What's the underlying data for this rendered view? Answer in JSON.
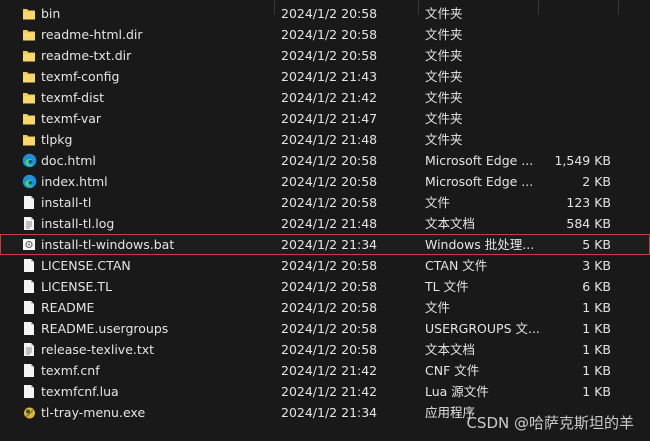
{
  "files": [
    {
      "name": "bin",
      "date": "2024/1/2 20:58",
      "type": "文件夹",
      "size": "",
      "icon": "folder-icon"
    },
    {
      "name": "readme-html.dir",
      "date": "2024/1/2 20:58",
      "type": "文件夹",
      "size": "",
      "icon": "folder-icon"
    },
    {
      "name": "readme-txt.dir",
      "date": "2024/1/2 20:58",
      "type": "文件夹",
      "size": "",
      "icon": "folder-icon"
    },
    {
      "name": "texmf-config",
      "date": "2024/1/2 21:43",
      "type": "文件夹",
      "size": "",
      "icon": "folder-icon"
    },
    {
      "name": "texmf-dist",
      "date": "2024/1/2 21:42",
      "type": "文件夹",
      "size": "",
      "icon": "folder-icon"
    },
    {
      "name": "texmf-var",
      "date": "2024/1/2 21:47",
      "type": "文件夹",
      "size": "",
      "icon": "folder-icon"
    },
    {
      "name": "tlpkg",
      "date": "2024/1/2 21:48",
      "type": "文件夹",
      "size": "",
      "icon": "folder-icon"
    },
    {
      "name": "doc.html",
      "date": "2024/1/2 20:58",
      "type": "Microsoft Edge ...",
      "size": "1,549 KB",
      "icon": "edge-icon"
    },
    {
      "name": "index.html",
      "date": "2024/1/2 20:58",
      "type": "Microsoft Edge ...",
      "size": "2 KB",
      "icon": "edge-icon"
    },
    {
      "name": "install-tl",
      "date": "2024/1/2 20:58",
      "type": "文件",
      "size": "123 KB",
      "icon": "file-icon"
    },
    {
      "name": "install-tl.log",
      "date": "2024/1/2 21:48",
      "type": "文本文档",
      "size": "584 KB",
      "icon": "text-file-icon"
    },
    {
      "name": "install-tl-windows.bat",
      "date": "2024/1/2 21:34",
      "type": "Windows 批处理...",
      "size": "5 KB",
      "icon": "batch-file-icon",
      "selected": true
    },
    {
      "name": "LICENSE.CTAN",
      "date": "2024/1/2 20:58",
      "type": "CTAN 文件",
      "size": "3 KB",
      "icon": "file-icon"
    },
    {
      "name": "LICENSE.TL",
      "date": "2024/1/2 20:58",
      "type": "TL 文件",
      "size": "6 KB",
      "icon": "file-icon"
    },
    {
      "name": "README",
      "date": "2024/1/2 20:58",
      "type": "文件",
      "size": "1 KB",
      "icon": "file-icon"
    },
    {
      "name": "README.usergroups",
      "date": "2024/1/2 20:58",
      "type": "USERGROUPS 文...",
      "size": "1 KB",
      "icon": "file-icon"
    },
    {
      "name": "release-texlive.txt",
      "date": "2024/1/2 20:58",
      "type": "文本文档",
      "size": "1 KB",
      "icon": "text-file-icon"
    },
    {
      "name": "texmf.cnf",
      "date": "2024/1/2 21:42",
      "type": "CNF 文件",
      "size": "1 KB",
      "icon": "file-icon"
    },
    {
      "name": "texmfcnf.lua",
      "date": "2024/1/2 21:42",
      "type": "Lua 源文件",
      "size": "1 KB",
      "icon": "file-icon"
    },
    {
      "name": "tl-tray-menu.exe",
      "date": "2024/1/2 21:34",
      "type": "应用程序",
      "size": "",
      "icon": "exe-icon"
    }
  ],
  "watermark": "CSDN @哈萨克斯坦的羊",
  "colors": {
    "background": "#191919",
    "text": "#e4e4e4",
    "folder": "#f2c94c",
    "edge": "#1f8fd9",
    "selection_border": "#c83c3c"
  }
}
